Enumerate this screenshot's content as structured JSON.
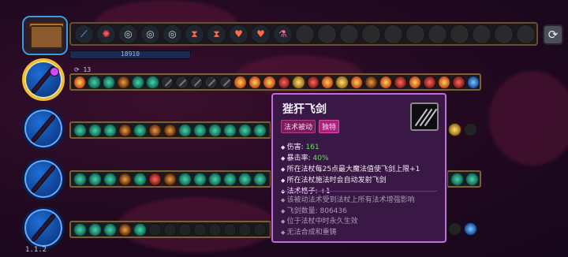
{
  "mana": {
    "value": "18910"
  },
  "toolbar": {
    "sort_icon": "refresh-icon"
  },
  "wand1": {
    "stats": "⟳ 13"
  },
  "tooltip": {
    "title": "狴犴飞剑",
    "tags": [
      "法术被动",
      "独特"
    ],
    "stats": {
      "damage_label": "伤害: ",
      "damage_value": "161",
      "crit_label": "暴击率: ",
      "crit_value": "40%",
      "line3": "所在法杖每25点最大魔法值使飞剑上限+1",
      "line4": "所在法杖施法时会自动发射飞剑",
      "slots_label": "法术格子: ",
      "slots_value": "+1"
    },
    "desc": [
      "该被动法术受到法杖上所有法术增强影响",
      "飞剑数量: 806436",
      "位于法杖中时永久生效",
      "无法合成和重铸"
    ]
  },
  "version": "1.1.2",
  "colors": {
    "tooltip_border": "#c56be0",
    "tag_passive": "#7a1d5a",
    "tag_unique": "#a8247a",
    "damage": "#5fe05a"
  }
}
